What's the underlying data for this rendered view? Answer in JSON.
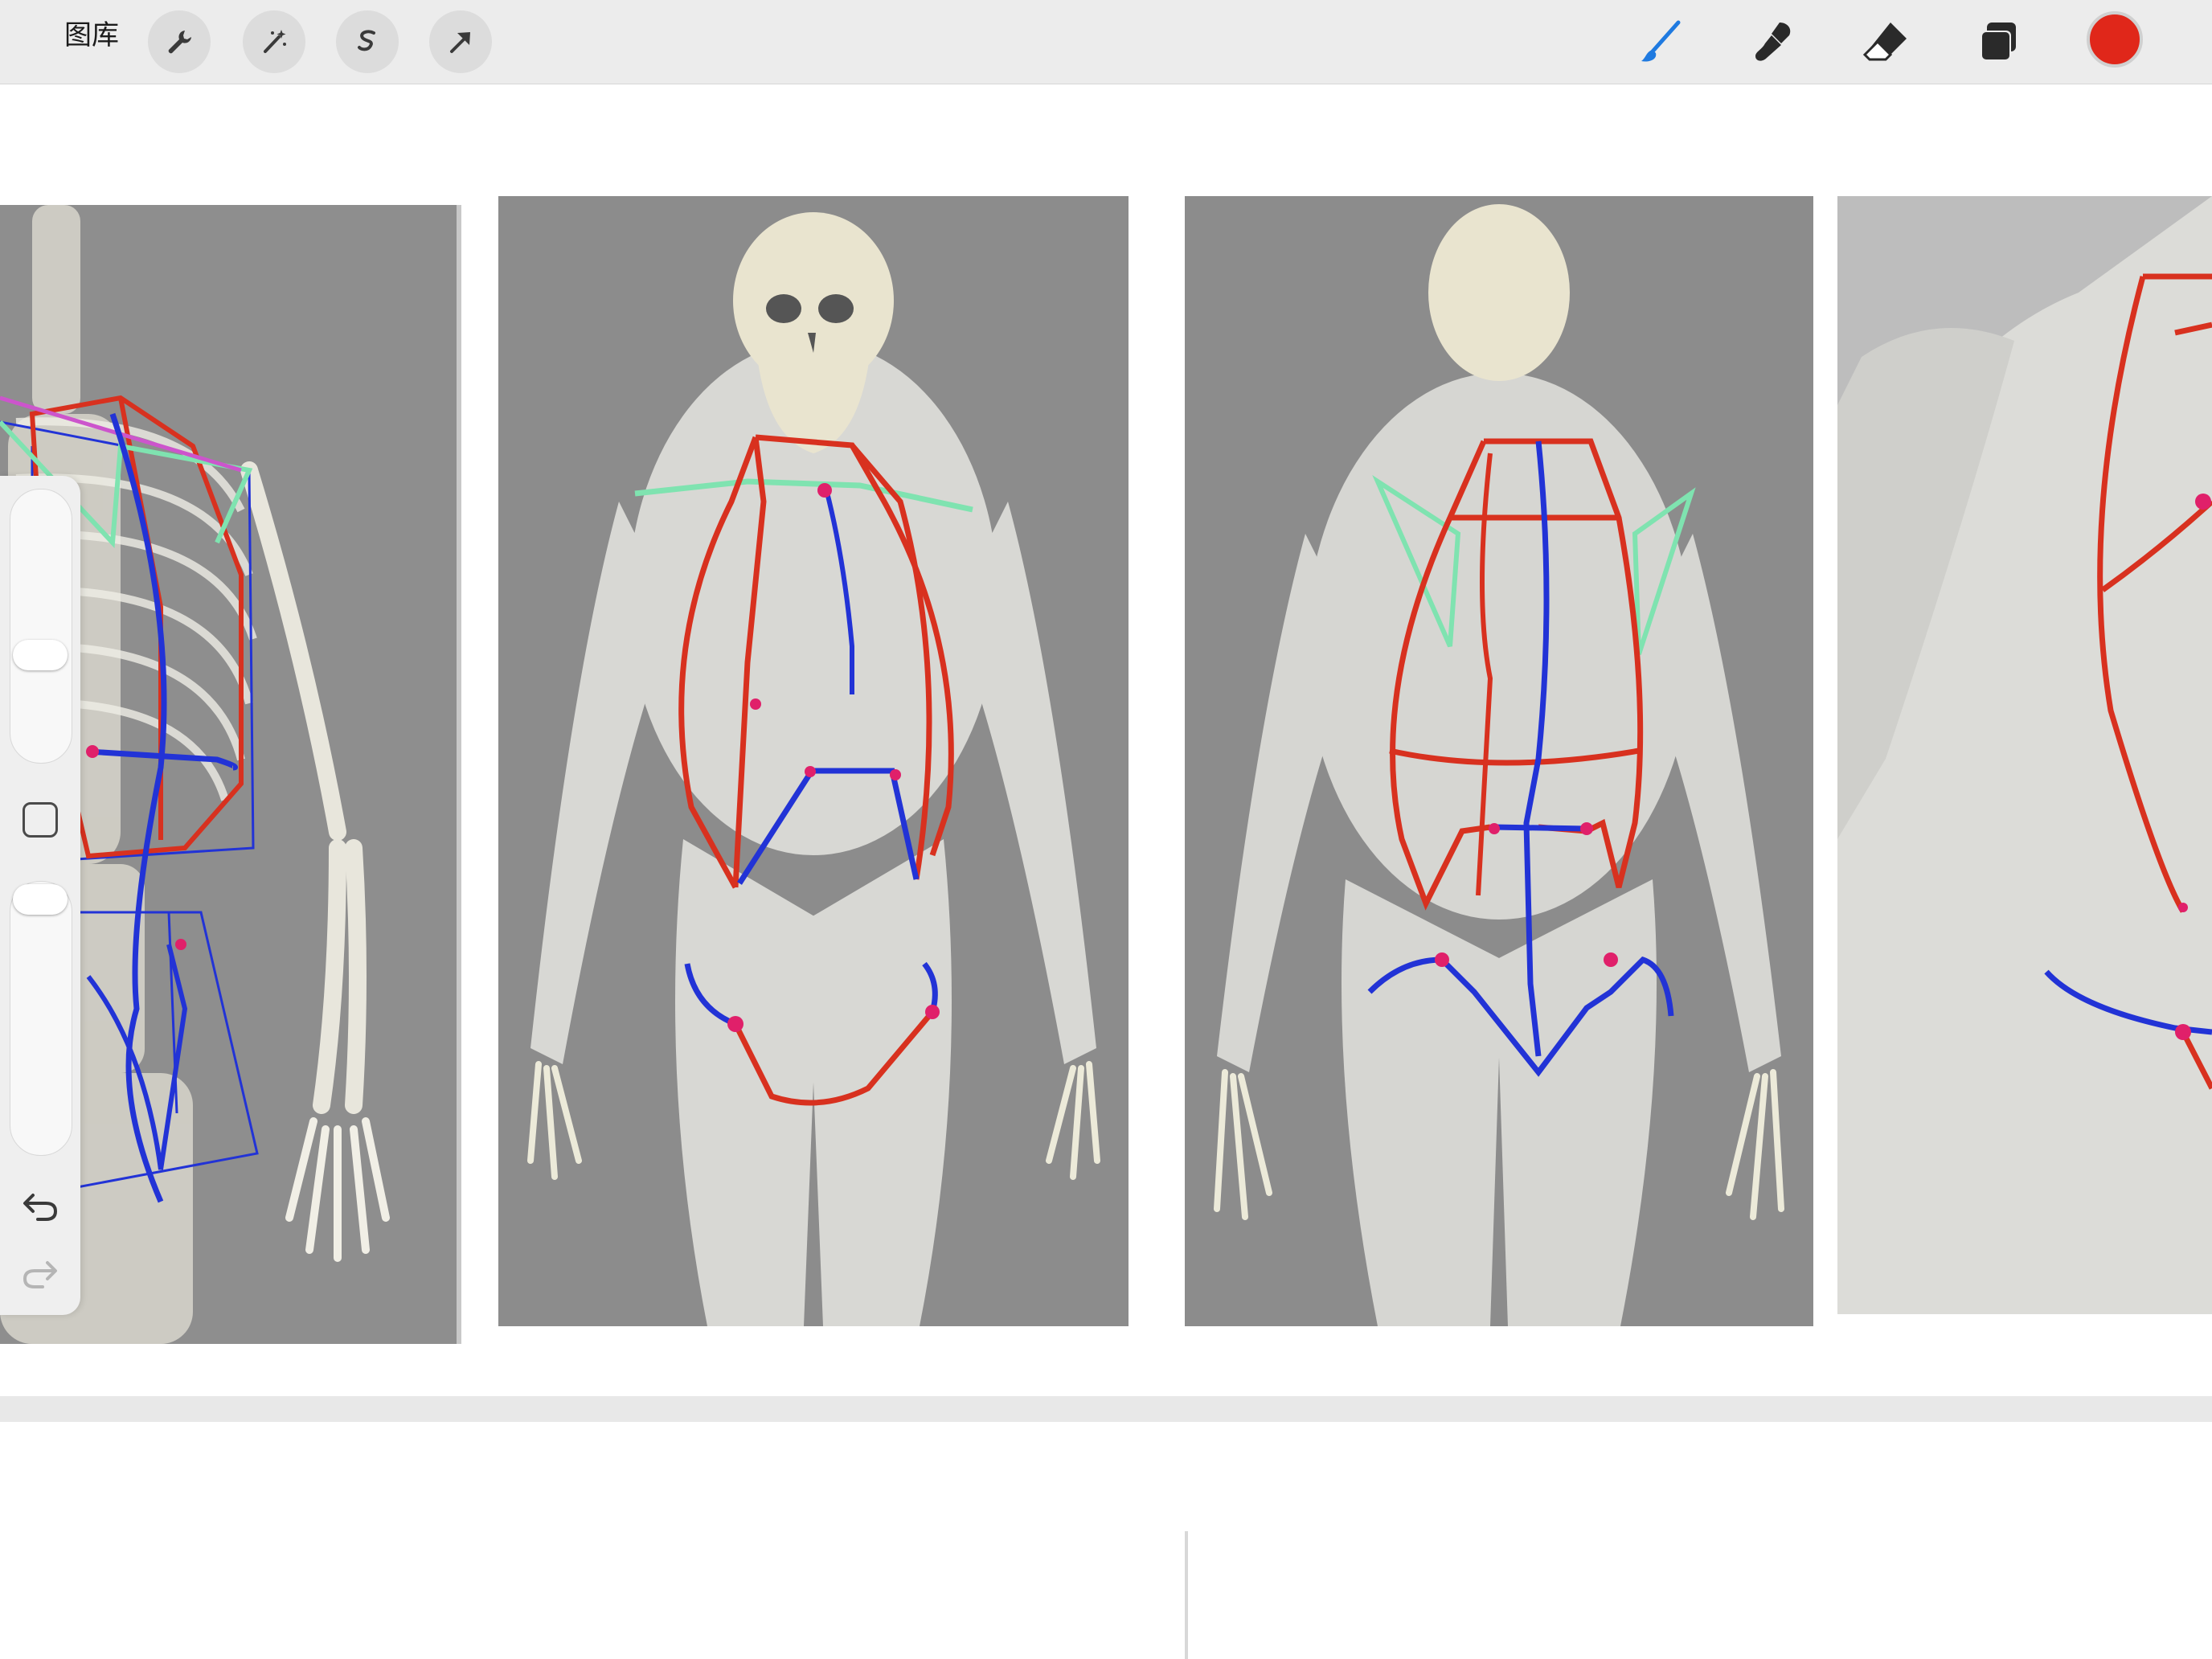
{
  "toolbar": {
    "gallery_label": "图库",
    "left_tools": [
      "wrench-icon",
      "magic-wand-icon",
      "selection-icon",
      "transform-arrow-icon"
    ],
    "right_tools": [
      "brush-icon",
      "smudge-icon",
      "eraser-icon",
      "layers-icon"
    ],
    "brush_color": "#e0271a",
    "active_tool_color": "#1f7ae0"
  },
  "sidebar": {
    "brush_size_level": 0.2,
    "opacity_level": 0.0,
    "buttons": [
      "undo-icon",
      "redo-icon",
      "modify-square-icon"
    ]
  },
  "canvas": {
    "panels": [
      "skeleton-side-view",
      "muscle-front-view",
      "muscle-back-view",
      "muscle-three-quarter-view"
    ],
    "stroke_colors": {
      "red": "#d8311f",
      "blue": "#2233d6",
      "green": "#7fe3b0",
      "pink": "#e0206a"
    }
  }
}
